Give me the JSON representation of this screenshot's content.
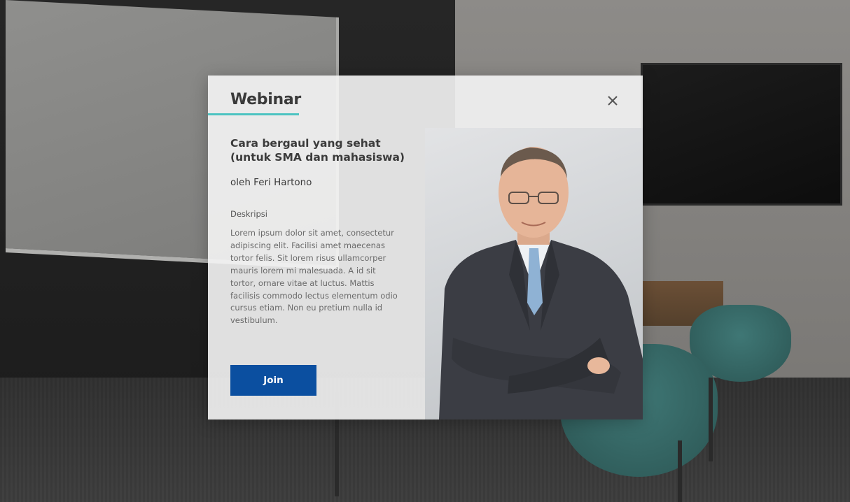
{
  "modal": {
    "title": "Webinar",
    "event_title": "Cara bergaul yang sehat (untuk SMA dan mahasiswa)",
    "speaker": "oleh Feri Hartono",
    "description_label": "Deskripsi",
    "description": "Lorem ipsum dolor sit amet, consectetur adipiscing elit. Facilisi amet maecenas tortor felis. Sit lorem risus ullamcorper mauris lorem mi malesuada. A id sit tortor, ornare vitae at luctus. Mattis facilisis commodo lectus elementum odio cursus etiam. Non eu pretium nulla id vestibulum.",
    "join_label": "Join",
    "close_icon": "close-icon",
    "speaker_photo_icon": "speaker-photo"
  },
  "colors": {
    "accent": "#4cc3c1",
    "primary_button": "#0b4fa0",
    "title_text": "#3a3a3a",
    "body_text": "#6a6a6a"
  }
}
